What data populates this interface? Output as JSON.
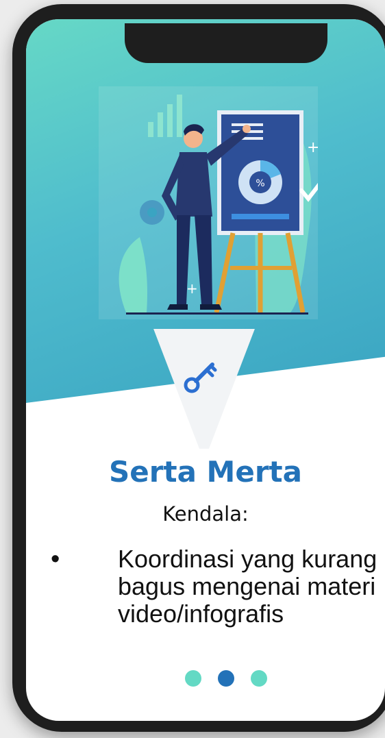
{
  "slide": {
    "title": "Serta Merta",
    "subtitle": "Kendala:",
    "bullets": [
      "Koordinasi yang kurang bagus mengenai materi video/infografis"
    ],
    "bullet_symbol": "•"
  },
  "pagination": {
    "total": 3,
    "active_index": 1,
    "active_color": "#2372b8",
    "inactive_color": "#63d9c4"
  },
  "icons": {
    "badge_icon": "key-icon",
    "illustration": "presentation-illustration"
  },
  "colors": {
    "title": "#2372b8",
    "hero_start": "#66d8c6",
    "hero_end": "#3aa4c2",
    "phone_frame": "#1e1e1e"
  }
}
